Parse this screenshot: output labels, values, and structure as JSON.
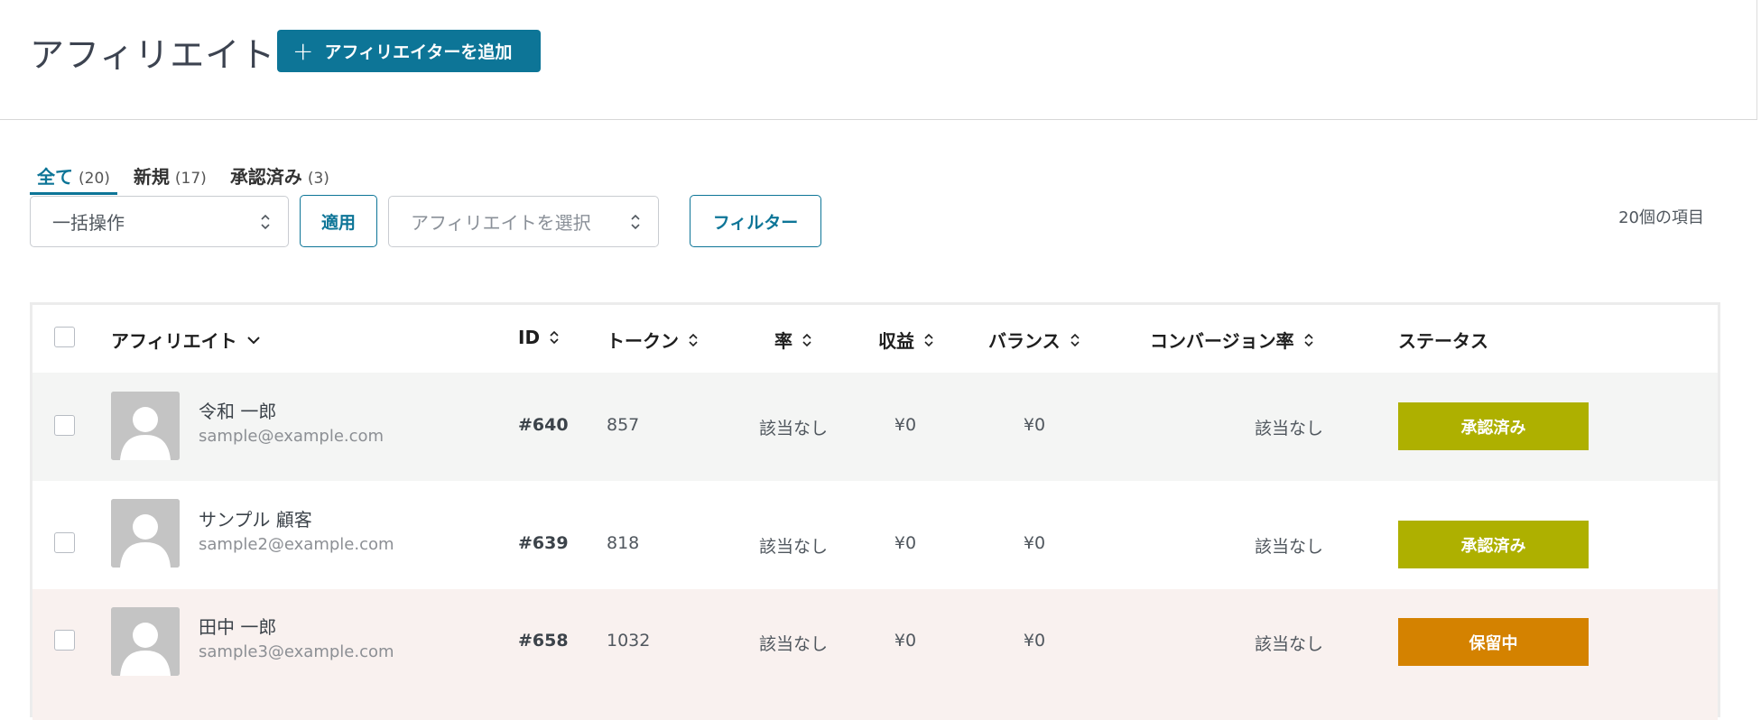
{
  "header": {
    "title": "アフィリエイト",
    "add_button": {
      "icon": "plus-icon",
      "label": "アフィリエイターを追加"
    }
  },
  "tabs": [
    {
      "label": "全て",
      "count": "(20)",
      "active": true
    },
    {
      "label": "新規",
      "count": "(17)",
      "active": false
    },
    {
      "label": "承認済み",
      "count": "(3)",
      "active": false
    }
  ],
  "toolbar": {
    "bulk_action": {
      "value": "一括操作"
    },
    "apply_label": "適用",
    "affiliate_select": {
      "placeholder": "アフィリエイトを選択"
    },
    "filter_label": "フィルター",
    "item_count": "20個の項目"
  },
  "table": {
    "columns": {
      "affiliate": "アフィリエイト",
      "id": "ID",
      "token": "トークン",
      "rate": "率",
      "earnings": "収益",
      "balance": "バランス",
      "conversion": "コンバージョン率",
      "status": "ステータス"
    },
    "rows": [
      {
        "name": "令和 一郎",
        "email": "sample@example.com",
        "id": "#640",
        "token": "857",
        "rate": "該当なし",
        "earnings": "¥0",
        "balance": "¥0",
        "conversion": "該当なし",
        "status": "承認済み"
      },
      {
        "name": "サンプル 顧客",
        "email": "sample2@example.com",
        "id": "#639",
        "token": "818",
        "rate": "該当なし",
        "earnings": "¥0",
        "balance": "¥0",
        "conversion": "該当なし",
        "status": "承認済み"
      },
      {
        "name": "田中 一郎",
        "email": "sample3@example.com",
        "id": "#658",
        "token": "1032",
        "rate": "該当なし",
        "earnings": "¥0",
        "balance": "¥0",
        "conversion": "該当なし",
        "status": "保留中"
      }
    ]
  },
  "colors": {
    "primary": "#0d7597",
    "status_approved": "#aeb000",
    "status_pending": "#d48200",
    "row_gray": "#f4f5f4",
    "row_pink": "#f9f1ef"
  }
}
